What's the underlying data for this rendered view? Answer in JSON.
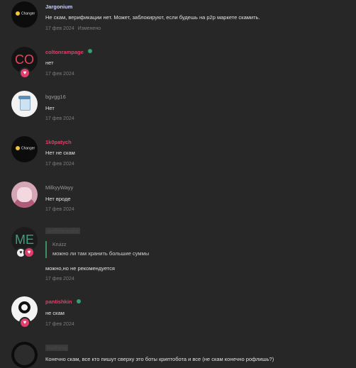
{
  "posts": [
    {
      "username": "Jargonium",
      "avatar_logo_text": "Jargonium Changer",
      "message": "Не скам, верификации нет. Может, заблокируют, если будешь на p2p маркете скамить.",
      "date": "17 фев 2024",
      "edited": "Изменено"
    },
    {
      "username": "coltonrampage",
      "avatar_text": "CO",
      "online": true,
      "message": "нет",
      "date": "17 фев 2024"
    },
    {
      "username": "bgvgg16",
      "message": "Нет",
      "date": "17 фев 2024"
    },
    {
      "username": "1k0patych",
      "avatar_logo_text": "Jargonium Changer",
      "message": "Нет не скам",
      "date": "17 фев 2024"
    },
    {
      "username": "MilkyyWayy",
      "message": "Нет вроде",
      "date": "17 фев 2024"
    },
    {
      "username": "mellinemalis",
      "avatar_text": "ME",
      "quote_author": "Kruizz",
      "quote_text": "можно ли там хранить большие суммы",
      "message": "можно,но не рекомендуется",
      "date": "17 фев 2024"
    },
    {
      "username": "pantishkin",
      "online": true,
      "message": "не скам",
      "date": "17 фев 2024"
    },
    {
      "username": "Nothing",
      "message": "Конечно скам, все кто пишут сверху это боты криптобота и все (не скам конечно рофлишь?)"
    }
  ],
  "colors": {
    "background": "#272727",
    "mod_name": "#cbd1ff",
    "red_name": "#e0406b",
    "online_dot": "#33a06e",
    "quote_bar": "#3f8f62"
  }
}
